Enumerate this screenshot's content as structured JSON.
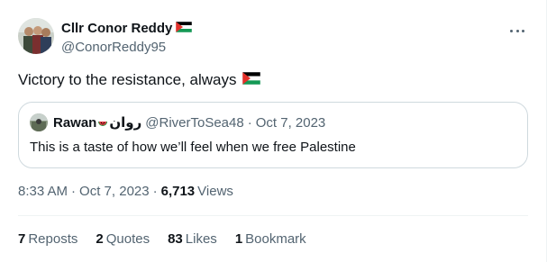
{
  "tweet": {
    "author": {
      "display_name": "Cllr Conor Reddy",
      "handle": "@ConorReddy95",
      "flag_icon": "palestine-flag-icon"
    },
    "text": "Victory to the resistance, always",
    "text_flag_icon": "palestine-flag-icon",
    "quote": {
      "display_name": "Rawan",
      "display_name_arabic": "روان",
      "display_name_icon": "watermelon-icon",
      "handle": "@RiverToSea48",
      "separator": "·",
      "date": "Oct 7, 2023",
      "text": "This is a taste of how we’ll feel when we free Palestine"
    },
    "meta": {
      "time": "8:33 AM",
      "separator": "·",
      "date": "Oct 7, 2023",
      "views_count": "6,713",
      "views_label": "Views"
    },
    "stats": {
      "reposts_count": "7",
      "reposts_label": "Reposts",
      "quotes_count": "2",
      "quotes_label": "Quotes",
      "likes_count": "83",
      "likes_label": "Likes",
      "bookmarks_count": "1",
      "bookmarks_label": "Bookmark"
    },
    "colors": {
      "text_primary": "#0f1419",
      "text_secondary": "#536471",
      "border": "#cfd9de",
      "flag_red": "#e4312b",
      "flag_green": "#149954",
      "flag_black": "#000000"
    }
  }
}
